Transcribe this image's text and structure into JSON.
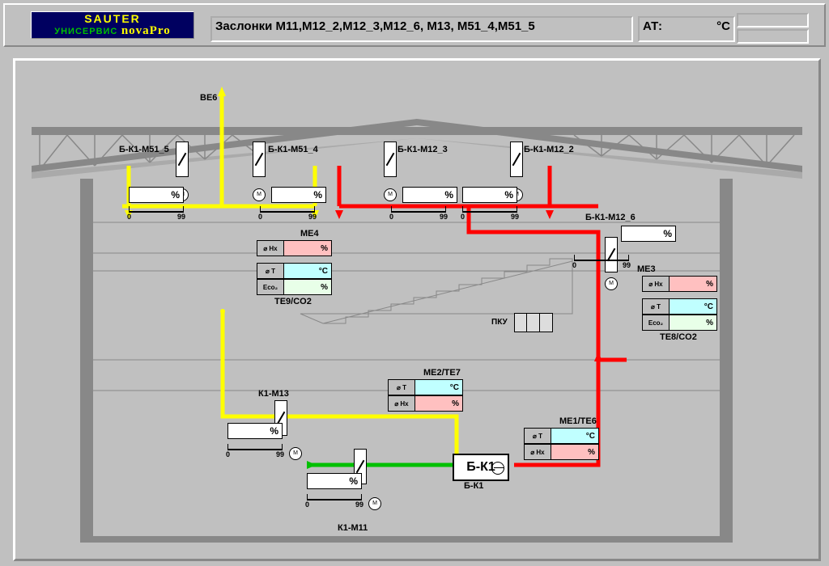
{
  "logo": {
    "l1": "SAUTER",
    "l2": "УНИСЕРВИС",
    "l3": "novaPro"
  },
  "title": "Заслонки M11,M12_2,M12_3,M12_6, M13, M51_4,M51_5",
  "at": {
    "label": "АТ:",
    "unit": "°C"
  },
  "labels": {
    "be6": "BE6",
    "m515": "Б-К1-M51_5",
    "m514": "Б-К1-M51_4",
    "m123": "Б-К1-M12_3",
    "m122": "Б-К1-M12_2",
    "m126": "Б-К1-M12_6",
    "m13": "К1-М13",
    "m11": "К1-М11",
    "bk1": "Б-К1",
    "me4": "ME4",
    "me3": "ME3",
    "te9": "TE9/CO2",
    "te8": "TE8/CO2",
    "me2": "ME2/TE7",
    "me1": "ME1/TE6",
    "pku": "ПКУ"
  },
  "slider": {
    "min": "0",
    "max": "99"
  },
  "units": {
    "pct": "%",
    "C": "°C"
  },
  "motor": "M",
  "ahu": "Б-К1",
  "icons": {
    "hx": "⌀ Hx",
    "t": "⌀ T",
    "eco2": "Eco₂"
  }
}
